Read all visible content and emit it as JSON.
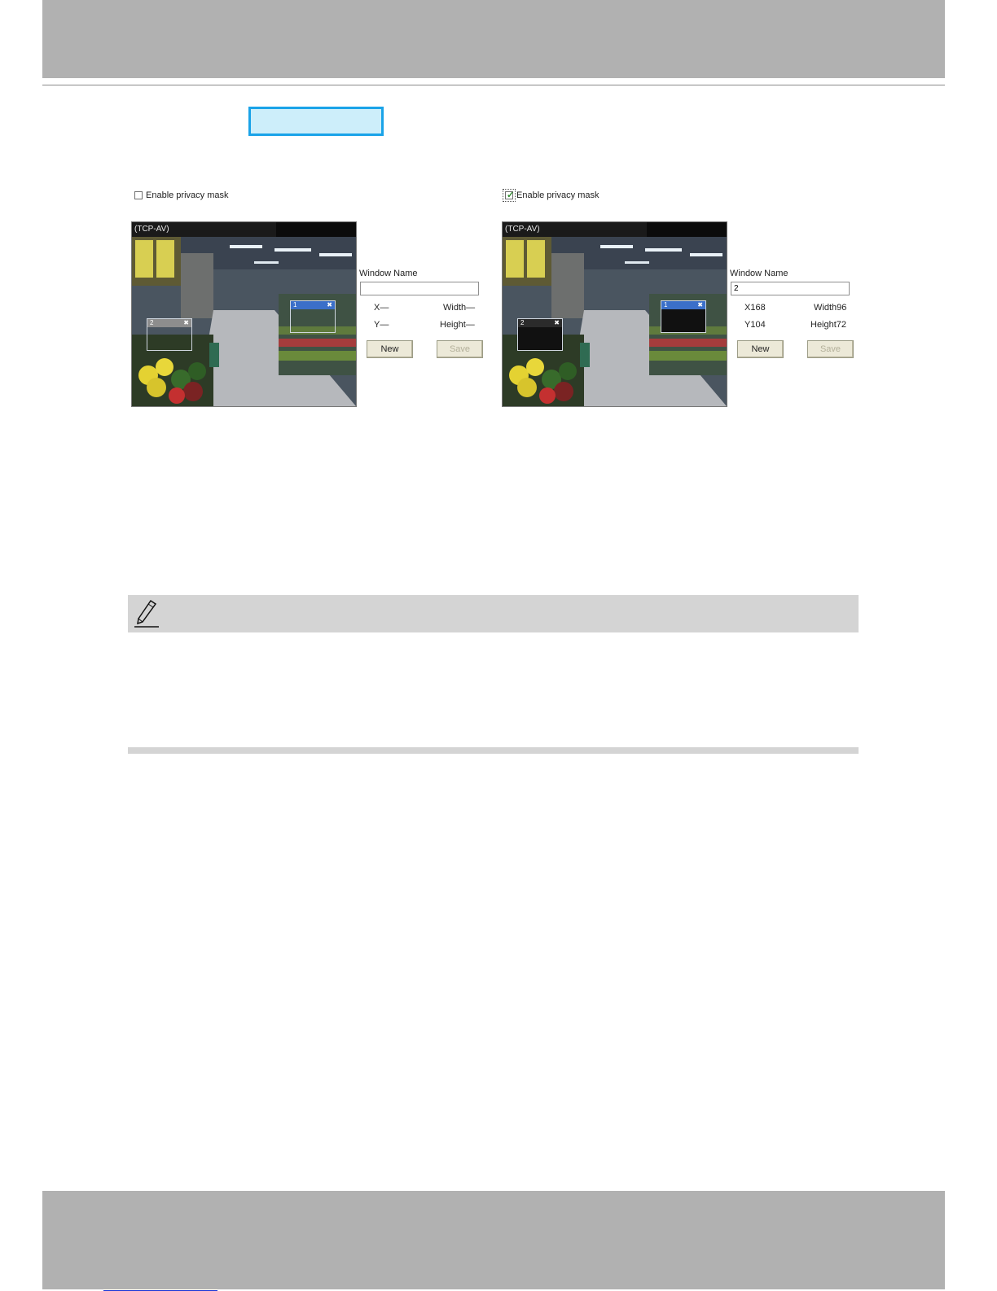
{
  "left_panel": {
    "checkbox_label": "Enable privacy mask",
    "checked": false,
    "video_title": "(TCP-AV)",
    "masks": [
      {
        "id": "1",
        "selected": true,
        "filled": false
      },
      {
        "id": "2",
        "selected": false,
        "filled": false
      }
    ],
    "window_name_label": "Window Name",
    "window_name_value": "",
    "x_label": "X—",
    "y_label": "Y—",
    "width_label": "Width—",
    "height_label": "Height—",
    "new_button": "New",
    "save_button": "Save",
    "close_glyph": "✖"
  },
  "right_panel": {
    "checkbox_label": "Enable privacy mask",
    "checked": true,
    "video_title": "(TCP-AV)",
    "masks": [
      {
        "id": "1",
        "selected": true,
        "filled": true
      },
      {
        "id": "2",
        "selected": false,
        "filled": true
      }
    ],
    "window_name_label": "Window Name",
    "window_name_value": "2",
    "x_label": "X168",
    "y_label": "Y104",
    "width_label": "Width96",
    "height_label": "Height72",
    "new_button": "New",
    "save_button": "Save",
    "close_glyph": "✖"
  },
  "icons": {
    "note": "pencil-icon",
    "check": "checkmark-icon"
  },
  "colors": {
    "header_band": "#b1b1b1",
    "highlight_border": "#1aa3e8",
    "highlight_fill": "#cdeefa",
    "note_bar": "#d4d4d4",
    "mask_selected": "#3b6fc9"
  }
}
